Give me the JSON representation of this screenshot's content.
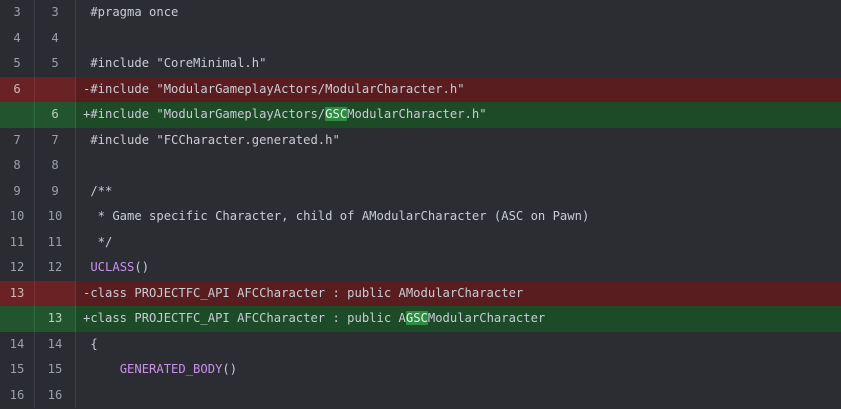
{
  "lines": [
    {
      "old": "3",
      "new": "3",
      "type": "ctx",
      "segments": [
        {
          "t": " #pragma once"
        }
      ]
    },
    {
      "old": "4",
      "new": "4",
      "type": "ctx",
      "segments": [
        {
          "t": ""
        }
      ]
    },
    {
      "old": "5",
      "new": "5",
      "type": "ctx",
      "segments": [
        {
          "t": " #include \"CoreMinimal.h\""
        }
      ]
    },
    {
      "old": "6",
      "new": "",
      "type": "del",
      "segments": [
        {
          "t": "-#include \"ModularGameplayActors/ModularCharacter.h\""
        }
      ]
    },
    {
      "old": "",
      "new": "6",
      "type": "add",
      "segments": [
        {
          "t": "+#include \"ModularGameplayActors/"
        },
        {
          "t": "GSC",
          "hl": true
        },
        {
          "t": "ModularCharacter.h\""
        }
      ]
    },
    {
      "old": "7",
      "new": "7",
      "type": "ctx",
      "segments": [
        {
          "t": " #include \"FCCharacter.generated.h\""
        }
      ]
    },
    {
      "old": "8",
      "new": "8",
      "type": "ctx",
      "segments": [
        {
          "t": ""
        }
      ]
    },
    {
      "old": "9",
      "new": "9",
      "type": "ctx",
      "segments": [
        {
          "t": " /**"
        }
      ]
    },
    {
      "old": "10",
      "new": "10",
      "type": "ctx",
      "segments": [
        {
          "t": "  * Game specific Character, child of AModularCharacter (ASC on Pawn)"
        }
      ]
    },
    {
      "old": "11",
      "new": "11",
      "type": "ctx",
      "segments": [
        {
          "t": "  */"
        }
      ]
    },
    {
      "old": "12",
      "new": "12",
      "type": "ctx",
      "segments": [
        {
          "t": " "
        },
        {
          "t": "UCLASS",
          "cls": "mac"
        },
        {
          "t": "()"
        }
      ]
    },
    {
      "old": "13",
      "new": "",
      "type": "del",
      "segments": [
        {
          "t": "-class PROJECTFC_API AFCCharacter : public AModularCharacter"
        }
      ]
    },
    {
      "old": "",
      "new": "13",
      "type": "add",
      "segments": [
        {
          "t": "+class PROJECTFC_API AFCCharacter : public A"
        },
        {
          "t": "GSC",
          "hl": true
        },
        {
          "t": "ModularCharacter"
        }
      ]
    },
    {
      "old": "14",
      "new": "14",
      "type": "ctx",
      "segments": [
        {
          "t": " {"
        }
      ]
    },
    {
      "old": "15",
      "new": "15",
      "type": "ctx",
      "segments": [
        {
          "t": "     "
        },
        {
          "t": "GENERATED_BODY",
          "cls": "mac"
        },
        {
          "t": "()"
        }
      ]
    },
    {
      "old": "16",
      "new": "16",
      "type": "ctx",
      "segments": [
        {
          "t": ""
        }
      ]
    }
  ]
}
